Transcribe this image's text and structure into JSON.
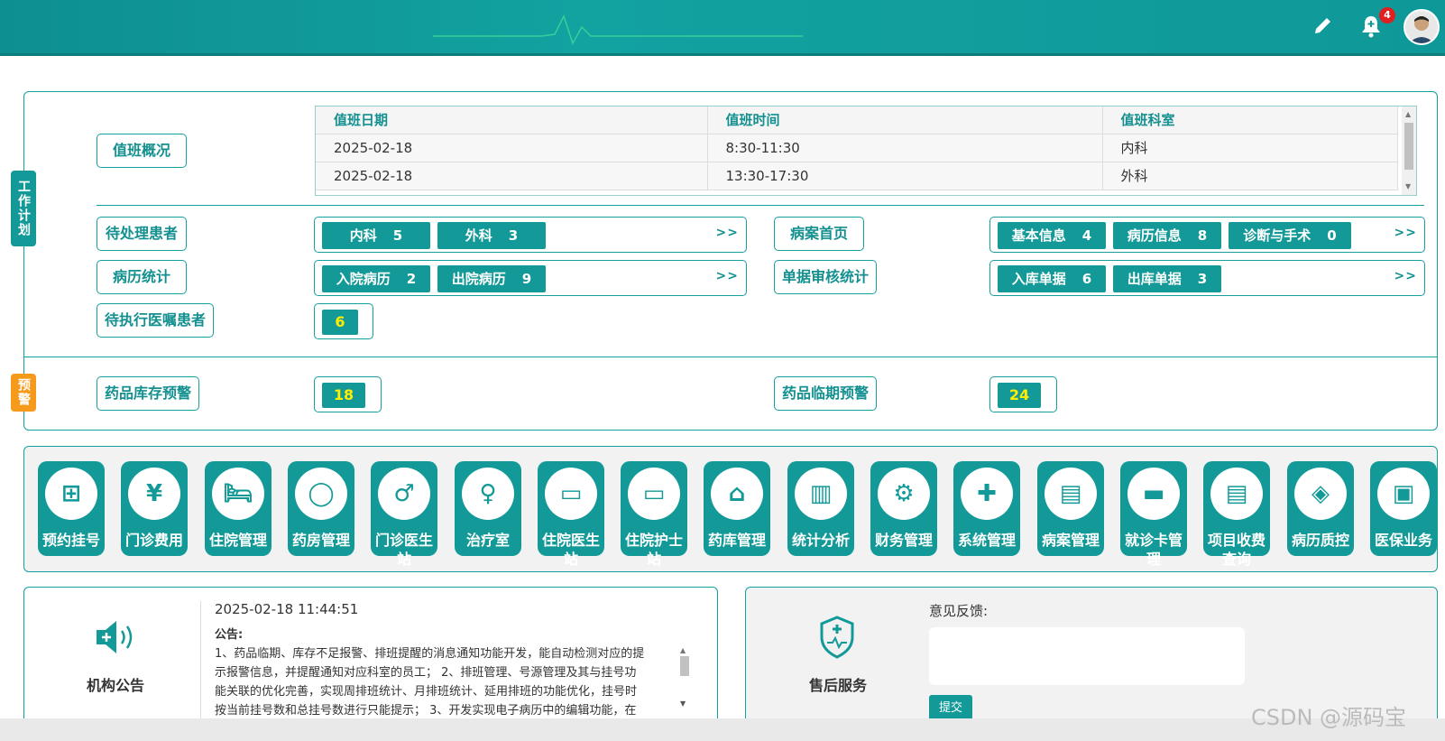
{
  "header": {
    "notifications_count": "4",
    "icons": [
      "edit-icon",
      "bell-icon",
      "avatar"
    ]
  },
  "work_plan": {
    "side_tag": "工作计划",
    "duty_overview_label": "值班概况",
    "duty_table": {
      "columns": [
        "值班日期",
        "值班时间",
        "值班科室"
      ],
      "rows": [
        [
          "2025-02-18",
          "8:30-11:30",
          "内科"
        ],
        [
          "2025-02-18",
          "13:30-17:30",
          "外科"
        ]
      ]
    },
    "pending_patients_label": "待处理患者",
    "pending_patients": [
      {
        "name": "内科",
        "count": "5"
      },
      {
        "name": "外科",
        "count": "3"
      }
    ],
    "record_home_label": "病案首页",
    "record_home": [
      {
        "name": "基本信息",
        "count": "4"
      },
      {
        "name": "病历信息",
        "count": "8"
      },
      {
        "name": "诊断与手术",
        "count": "0"
      }
    ],
    "record_stats_label": "病历统计",
    "record_stats": [
      {
        "name": "入院病历",
        "count": "2"
      },
      {
        "name": "出院病历",
        "count": "9"
      }
    ],
    "doc_audit_label": "单据审核统计",
    "doc_audit": [
      {
        "name": "入库单据",
        "count": "6"
      },
      {
        "name": "出库单据",
        "count": "3"
      }
    ],
    "pending_orders_label": "待执行医嘱患者",
    "pending_orders_count": "6",
    "more": ">>"
  },
  "warning": {
    "side_tag": "预警",
    "stock_label": "药品库存预警",
    "stock_count": "18",
    "expiry_label": "药品临期预警",
    "expiry_count": "24"
  },
  "modules": [
    {
      "label": "预约挂号",
      "label2": "",
      "icon": "calendar-plus-icon"
    },
    {
      "label": "门诊费用",
      "label2": "",
      "icon": "yen-icon"
    },
    {
      "label": "住院管理",
      "label2": "",
      "icon": "bed-icon"
    },
    {
      "label": "药房管理",
      "label2": "",
      "icon": "pill-icon"
    },
    {
      "label": "门诊医生",
      "label2": "站",
      "icon": "doctor-icon"
    },
    {
      "label": "治疗室",
      "label2": "",
      "icon": "nurse-icon"
    },
    {
      "label": "住院医生",
      "label2": "站",
      "icon": "doctor-desk-icon"
    },
    {
      "label": "住院护士",
      "label2": "站",
      "icon": "nurse-desk-icon"
    },
    {
      "label": "药库管理",
      "label2": "",
      "icon": "warehouse-icon"
    },
    {
      "label": "统计分析",
      "label2": "",
      "icon": "bar-chart-icon"
    },
    {
      "label": "财务管理",
      "label2": "",
      "icon": "finance-gear-icon"
    },
    {
      "label": "系统管理",
      "label2": "",
      "icon": "gear-plus-icon"
    },
    {
      "label": "病案管理",
      "label2": "",
      "icon": "record-icon"
    },
    {
      "label": "就诊卡管",
      "label2": "理",
      "icon": "card-icon"
    },
    {
      "label": "项目收费",
      "label2": "查询",
      "icon": "search-doc-icon"
    },
    {
      "label": "病历质控",
      "label2": "",
      "icon": "shield-doc-icon"
    },
    {
      "label": "医保业务",
      "label2": "",
      "icon": "id-card-icon"
    }
  ],
  "notice": {
    "title": "机构公告",
    "timestamp": "2025-02-18 11:44:51",
    "heading": "公告:",
    "lines": [
      "1、药品临期、库存不足报警、排班提醒的消息通知功能开发，能自动检测对应的提",
      "示报警信息，并提醒通知对应科室的员工；  2、排班管理、号源管理及其与挂号功",
      "能关联的优化完善，实现周排班统计、月排班统计、延用排班的功能优化，挂号时",
      "按当前挂号数和总挂号数进行只能提示；  3、开发实现电子病历中的编辑功能，在"
    ]
  },
  "service": {
    "title": "售后服务",
    "feedback_label": "意见反馈:",
    "submit_label": "提交"
  },
  "watermark": "CSDN @源码宝"
}
